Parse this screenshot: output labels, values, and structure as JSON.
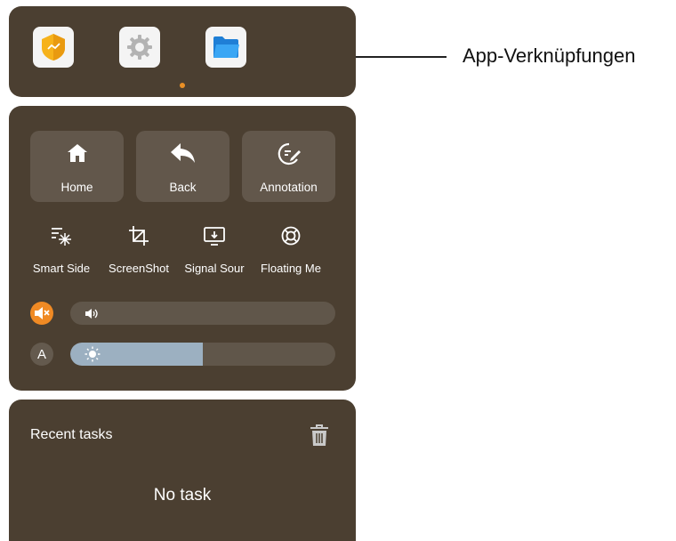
{
  "apps": {
    "items": [
      {
        "name": "security-app-icon"
      },
      {
        "name": "settings-app-icon"
      },
      {
        "name": "file-manager-app-icon"
      }
    ],
    "page_indicator_color": "#e98f25"
  },
  "controls": {
    "home_label": "Home",
    "back_label": "Back",
    "annotation_label": "Annotation",
    "tools": [
      {
        "label": "Smart Side",
        "icon": "smart-side-icon"
      },
      {
        "label": "ScreenShot",
        "icon": "crop-icon"
      },
      {
        "label": "Signal Sour",
        "icon": "signal-source-icon"
      },
      {
        "label": "Floating Me",
        "icon": "floating-menu-icon"
      }
    ],
    "volume": {
      "muted": true,
      "level": 0,
      "mute_color": "#f08a24"
    },
    "brightness": {
      "auto_label": "A",
      "level": 0.5,
      "fill_color": "#9cb0c1"
    }
  },
  "recent": {
    "title": "Recent tasks",
    "empty_text": "No task"
  },
  "callout": {
    "label": "App-Verknüpfungen"
  },
  "colors": {
    "panel_bg": "#4b3f31",
    "accent": "#e98f25"
  }
}
